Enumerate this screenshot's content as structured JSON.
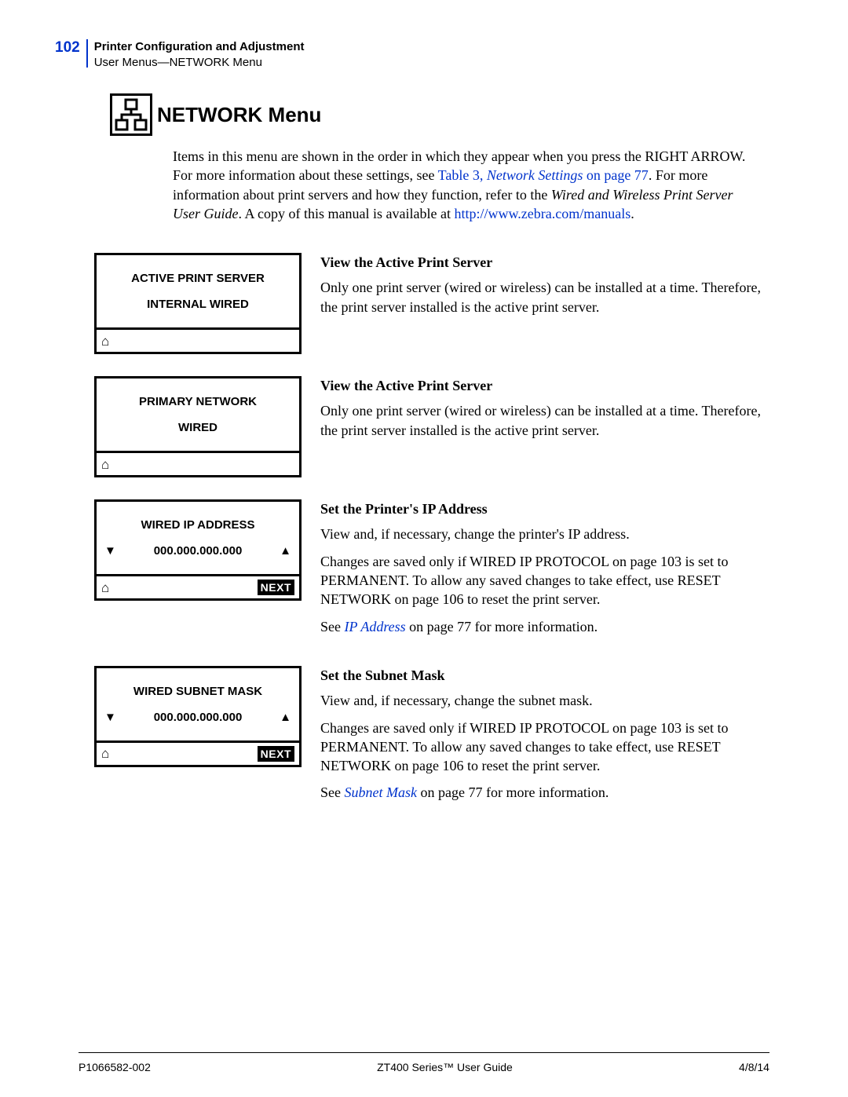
{
  "header": {
    "page_num": "102",
    "title_top": "Printer Configuration and Adjustment",
    "title_sub": "User Menus—NETWORK Menu"
  },
  "section_title": "NETWORK Menu",
  "intro": {
    "t1": "Items in this menu are shown in the order in which they appear when you press the RIGHT ARROW. For more information about these settings, see ",
    "link1": "Table 3, ",
    "link1_i": "Network Settings",
    "link1_tail": " on page 77",
    "t2": ". For more information about print servers and how they function, refer to the ",
    "italic": "Wired and Wireless Print Server User Guide",
    "t3": ". A copy of this manual is available at ",
    "link2": "http://www.zebra.com/manuals",
    "t4": "."
  },
  "entries": [
    {
      "lcd_title": "ACTIVE PRINT SERVER",
      "lcd_value": "INTERNAL WIRED",
      "has_arrows": false,
      "has_next": false,
      "desc_title": "View the Active Print Server",
      "p1": "Only one print server (wired or wireless) can be installed at a time. Therefore, the print server installed is the active print server."
    },
    {
      "lcd_title": "PRIMARY NETWORK",
      "lcd_value": "WIRED",
      "has_arrows": false,
      "has_next": false,
      "desc_title": "View the Active Print Server",
      "p1": "Only one print server (wired or wireless) can be installed at a time. Therefore, the print server installed is the active print server."
    },
    {
      "lcd_title": "WIRED IP ADDRESS",
      "lcd_value": "000.000.000.000",
      "has_arrows": true,
      "has_next": true,
      "desc_title": "Set the Printer's IP Address",
      "p1": "View and, if necessary, change the printer's IP address.",
      "p2_a": "Changes are saved only if ",
      "p2_link1": "WIRED IP PROTOCOL on page 103",
      "p2_b": " is set to PERMANENT. To allow any saved changes to take effect, use ",
      "p2_link2": "RESET NETWORK on page 106",
      "p2_c": " to reset the print server.",
      "p3_a": "See ",
      "p3_link_i": "IP Address",
      "p3_link_tail": " on page 77",
      "p3_b": " for more information."
    },
    {
      "lcd_title": "WIRED SUBNET MASK",
      "lcd_value": "000.000.000.000",
      "has_arrows": true,
      "has_next": true,
      "desc_title": "Set the Subnet Mask",
      "p1": "View and, if necessary, change the subnet mask.",
      "p2_a": "Changes are saved only if ",
      "p2_link1": "WIRED IP PROTOCOL on page 103",
      "p2_b": " is set to PERMANENT. To allow any saved changes to take effect, use ",
      "p2_link2": "RESET NETWORK on page 106",
      "p2_c": " to reset the print server.",
      "p3_a": "See ",
      "p3_link_i": "Subnet Mask",
      "p3_link_tail": " on page 77",
      "p3_b": " for more information."
    }
  ],
  "next_label": "NEXT",
  "footer": {
    "left": "P1066582-002",
    "center": "ZT400 Series™ User Guide",
    "right": "4/8/14"
  }
}
